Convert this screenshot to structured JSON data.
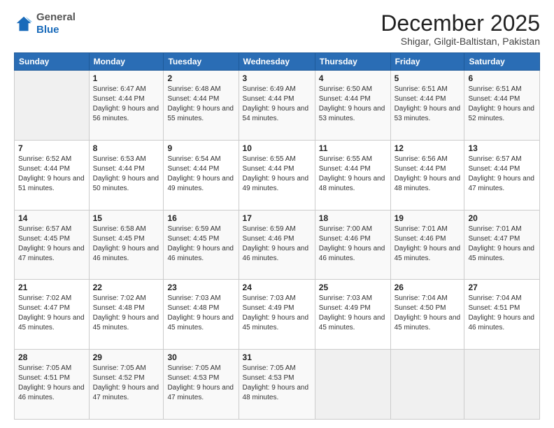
{
  "header": {
    "logo_general": "General",
    "logo_blue": "Blue",
    "month_title": "December 2025",
    "subtitle": "Shigar, Gilgit-Baltistan, Pakistan"
  },
  "days_of_week": [
    "Sunday",
    "Monday",
    "Tuesday",
    "Wednesday",
    "Thursday",
    "Friday",
    "Saturday"
  ],
  "weeks": [
    [
      {
        "day": "",
        "sunrise": "",
        "sunset": "",
        "daylight": ""
      },
      {
        "day": "1",
        "sunrise": "Sunrise: 6:47 AM",
        "sunset": "Sunset: 4:44 PM",
        "daylight": "Daylight: 9 hours and 56 minutes."
      },
      {
        "day": "2",
        "sunrise": "Sunrise: 6:48 AM",
        "sunset": "Sunset: 4:44 PM",
        "daylight": "Daylight: 9 hours and 55 minutes."
      },
      {
        "day": "3",
        "sunrise": "Sunrise: 6:49 AM",
        "sunset": "Sunset: 4:44 PM",
        "daylight": "Daylight: 9 hours and 54 minutes."
      },
      {
        "day": "4",
        "sunrise": "Sunrise: 6:50 AM",
        "sunset": "Sunset: 4:44 PM",
        "daylight": "Daylight: 9 hours and 53 minutes."
      },
      {
        "day": "5",
        "sunrise": "Sunrise: 6:51 AM",
        "sunset": "Sunset: 4:44 PM",
        "daylight": "Daylight: 9 hours and 53 minutes."
      },
      {
        "day": "6",
        "sunrise": "Sunrise: 6:51 AM",
        "sunset": "Sunset: 4:44 PM",
        "daylight": "Daylight: 9 hours and 52 minutes."
      }
    ],
    [
      {
        "day": "7",
        "sunrise": "Sunrise: 6:52 AM",
        "sunset": "Sunset: 4:44 PM",
        "daylight": "Daylight: 9 hours and 51 minutes."
      },
      {
        "day": "8",
        "sunrise": "Sunrise: 6:53 AM",
        "sunset": "Sunset: 4:44 PM",
        "daylight": "Daylight: 9 hours and 50 minutes."
      },
      {
        "day": "9",
        "sunrise": "Sunrise: 6:54 AM",
        "sunset": "Sunset: 4:44 PM",
        "daylight": "Daylight: 9 hours and 49 minutes."
      },
      {
        "day": "10",
        "sunrise": "Sunrise: 6:55 AM",
        "sunset": "Sunset: 4:44 PM",
        "daylight": "Daylight: 9 hours and 49 minutes."
      },
      {
        "day": "11",
        "sunrise": "Sunrise: 6:55 AM",
        "sunset": "Sunset: 4:44 PM",
        "daylight": "Daylight: 9 hours and 48 minutes."
      },
      {
        "day": "12",
        "sunrise": "Sunrise: 6:56 AM",
        "sunset": "Sunset: 4:44 PM",
        "daylight": "Daylight: 9 hours and 48 minutes."
      },
      {
        "day": "13",
        "sunrise": "Sunrise: 6:57 AM",
        "sunset": "Sunset: 4:44 PM",
        "daylight": "Daylight: 9 hours and 47 minutes."
      }
    ],
    [
      {
        "day": "14",
        "sunrise": "Sunrise: 6:57 AM",
        "sunset": "Sunset: 4:45 PM",
        "daylight": "Daylight: 9 hours and 47 minutes."
      },
      {
        "day": "15",
        "sunrise": "Sunrise: 6:58 AM",
        "sunset": "Sunset: 4:45 PM",
        "daylight": "Daylight: 9 hours and 46 minutes."
      },
      {
        "day": "16",
        "sunrise": "Sunrise: 6:59 AM",
        "sunset": "Sunset: 4:45 PM",
        "daylight": "Daylight: 9 hours and 46 minutes."
      },
      {
        "day": "17",
        "sunrise": "Sunrise: 6:59 AM",
        "sunset": "Sunset: 4:46 PM",
        "daylight": "Daylight: 9 hours and 46 minutes."
      },
      {
        "day": "18",
        "sunrise": "Sunrise: 7:00 AM",
        "sunset": "Sunset: 4:46 PM",
        "daylight": "Daylight: 9 hours and 46 minutes."
      },
      {
        "day": "19",
        "sunrise": "Sunrise: 7:01 AM",
        "sunset": "Sunset: 4:46 PM",
        "daylight": "Daylight: 9 hours and 45 minutes."
      },
      {
        "day": "20",
        "sunrise": "Sunrise: 7:01 AM",
        "sunset": "Sunset: 4:47 PM",
        "daylight": "Daylight: 9 hours and 45 minutes."
      }
    ],
    [
      {
        "day": "21",
        "sunrise": "Sunrise: 7:02 AM",
        "sunset": "Sunset: 4:47 PM",
        "daylight": "Daylight: 9 hours and 45 minutes."
      },
      {
        "day": "22",
        "sunrise": "Sunrise: 7:02 AM",
        "sunset": "Sunset: 4:48 PM",
        "daylight": "Daylight: 9 hours and 45 minutes."
      },
      {
        "day": "23",
        "sunrise": "Sunrise: 7:03 AM",
        "sunset": "Sunset: 4:48 PM",
        "daylight": "Daylight: 9 hours and 45 minutes."
      },
      {
        "day": "24",
        "sunrise": "Sunrise: 7:03 AM",
        "sunset": "Sunset: 4:49 PM",
        "daylight": "Daylight: 9 hours and 45 minutes."
      },
      {
        "day": "25",
        "sunrise": "Sunrise: 7:03 AM",
        "sunset": "Sunset: 4:49 PM",
        "daylight": "Daylight: 9 hours and 45 minutes."
      },
      {
        "day": "26",
        "sunrise": "Sunrise: 7:04 AM",
        "sunset": "Sunset: 4:50 PM",
        "daylight": "Daylight: 9 hours and 45 minutes."
      },
      {
        "day": "27",
        "sunrise": "Sunrise: 7:04 AM",
        "sunset": "Sunset: 4:51 PM",
        "daylight": "Daylight: 9 hours and 46 minutes."
      }
    ],
    [
      {
        "day": "28",
        "sunrise": "Sunrise: 7:05 AM",
        "sunset": "Sunset: 4:51 PM",
        "daylight": "Daylight: 9 hours and 46 minutes."
      },
      {
        "day": "29",
        "sunrise": "Sunrise: 7:05 AM",
        "sunset": "Sunset: 4:52 PM",
        "daylight": "Daylight: 9 hours and 47 minutes."
      },
      {
        "day": "30",
        "sunrise": "Sunrise: 7:05 AM",
        "sunset": "Sunset: 4:53 PM",
        "daylight": "Daylight: 9 hours and 47 minutes."
      },
      {
        "day": "31",
        "sunrise": "Sunrise: 7:05 AM",
        "sunset": "Sunset: 4:53 PM",
        "daylight": "Daylight: 9 hours and 48 minutes."
      },
      {
        "day": "",
        "sunrise": "",
        "sunset": "",
        "daylight": ""
      },
      {
        "day": "",
        "sunrise": "",
        "sunset": "",
        "daylight": ""
      },
      {
        "day": "",
        "sunrise": "",
        "sunset": "",
        "daylight": ""
      }
    ]
  ]
}
